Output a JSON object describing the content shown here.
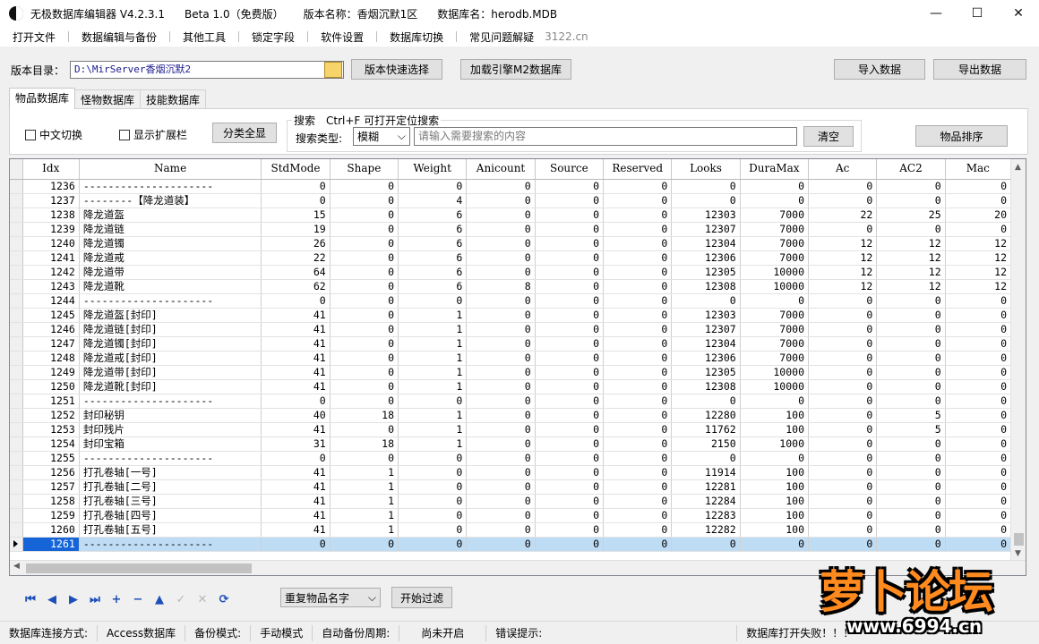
{
  "window": {
    "title_segments": [
      "无极数据库编辑器 V4.2.3.1",
      "Beta 1.0（免费版）",
      "版本名称：香烟沉默1区",
      "数据库名：herodb.MDB"
    ],
    "controls": {
      "minimize": "—",
      "maximize": "☐",
      "close": "✕"
    }
  },
  "menu": {
    "items": [
      "打开文件",
      "数据编辑与备份",
      "其他工具",
      "锁定字段",
      "软件设置",
      "数据库切换",
      "常见问题解疑"
    ],
    "site": "3122.cn"
  },
  "toolbar": {
    "dir_label": "版本目录：",
    "dir_value": "D:\\MirServer香烟沉默2",
    "quick_select": "版本快速选择",
    "load_engine": "加载引擎M2数据库",
    "import": "导入数据",
    "export": "导出数据"
  },
  "tabs": [
    "物品数据库",
    "怪物数据库",
    "技能数据库"
  ],
  "filters": {
    "chinese_switch": "中文切换",
    "show_ext": "显示扩展栏",
    "show_all": "分类全显",
    "search_title": "搜索　Ctrl+F 可打开定位搜索",
    "search_type_label": "搜索类型:",
    "search_type": "模糊",
    "search_placeholder": "请输入需要搜索的内容",
    "clear": "清空",
    "sort": "物品排序"
  },
  "grid": {
    "columns": [
      "Idx",
      "Name",
      "StdMode",
      "Shape",
      "Weight",
      "Anicount",
      "Source",
      "Reserved",
      "Looks",
      "DuraMax",
      "Ac",
      "AC2",
      "Mac"
    ],
    "rows": [
      [
        "1236",
        "---------------------",
        "0",
        "0",
        "0",
        "0",
        "0",
        "0",
        "0",
        "0",
        "0",
        "0",
        "0"
      ],
      [
        "1237",
        "--------【降龙道装】",
        "0",
        "0",
        "4",
        "0",
        "0",
        "0",
        "0",
        "0",
        "0",
        "0",
        "0"
      ],
      [
        "1238",
        "降龙道盔",
        "15",
        "0",
        "6",
        "0",
        "0",
        "0",
        "12303",
        "7000",
        "22",
        "25",
        "20"
      ],
      [
        "1239",
        "降龙道链",
        "19",
        "0",
        "6",
        "0",
        "0",
        "0",
        "12307",
        "7000",
        "0",
        "0",
        "0"
      ],
      [
        "1240",
        "降龙道镯",
        "26",
        "0",
        "6",
        "0",
        "0",
        "0",
        "12304",
        "7000",
        "12",
        "12",
        "12"
      ],
      [
        "1241",
        "降龙道戒",
        "22",
        "0",
        "6",
        "0",
        "0",
        "0",
        "12306",
        "7000",
        "12",
        "12",
        "12"
      ],
      [
        "1242",
        "降龙道带",
        "64",
        "0",
        "6",
        "0",
        "0",
        "0",
        "12305",
        "10000",
        "12",
        "12",
        "12"
      ],
      [
        "1243",
        "降龙道靴",
        "62",
        "0",
        "6",
        "8",
        "0",
        "0",
        "12308",
        "10000",
        "12",
        "12",
        "12"
      ],
      [
        "1244",
        "---------------------",
        "0",
        "0",
        "0",
        "0",
        "0",
        "0",
        "0",
        "0",
        "0",
        "0",
        "0"
      ],
      [
        "1245",
        "降龙道盔[封印]",
        "41",
        "0",
        "1",
        "0",
        "0",
        "0",
        "12303",
        "7000",
        "0",
        "0",
        "0"
      ],
      [
        "1246",
        "降龙道链[封印]",
        "41",
        "0",
        "1",
        "0",
        "0",
        "0",
        "12307",
        "7000",
        "0",
        "0",
        "0"
      ],
      [
        "1247",
        "降龙道镯[封印]",
        "41",
        "0",
        "1",
        "0",
        "0",
        "0",
        "12304",
        "7000",
        "0",
        "0",
        "0"
      ],
      [
        "1248",
        "降龙道戒[封印]",
        "41",
        "0",
        "1",
        "0",
        "0",
        "0",
        "12306",
        "7000",
        "0",
        "0",
        "0"
      ],
      [
        "1249",
        "降龙道带[封印]",
        "41",
        "0",
        "1",
        "0",
        "0",
        "0",
        "12305",
        "10000",
        "0",
        "0",
        "0"
      ],
      [
        "1250",
        "降龙道靴[封印]",
        "41",
        "0",
        "1",
        "0",
        "0",
        "0",
        "12308",
        "10000",
        "0",
        "0",
        "0"
      ],
      [
        "1251",
        "---------------------",
        "0",
        "0",
        "0",
        "0",
        "0",
        "0",
        "0",
        "0",
        "0",
        "0",
        "0"
      ],
      [
        "1252",
        "封印秘钥",
        "40",
        "18",
        "1",
        "0",
        "0",
        "0",
        "12280",
        "100",
        "0",
        "5",
        "0"
      ],
      [
        "1253",
        "封印残片",
        "41",
        "0",
        "1",
        "0",
        "0",
        "0",
        "11762",
        "100",
        "0",
        "5",
        "0"
      ],
      [
        "1254",
        "封印宝箱",
        "31",
        "18",
        "1",
        "0",
        "0",
        "0",
        "2150",
        "1000",
        "0",
        "0",
        "0"
      ],
      [
        "1255",
        "---------------------",
        "0",
        "0",
        "0",
        "0",
        "0",
        "0",
        "0",
        "0",
        "0",
        "0",
        "0"
      ],
      [
        "1256",
        "打孔卷轴[一号]",
        "41",
        "1",
        "0",
        "0",
        "0",
        "0",
        "11914",
        "100",
        "0",
        "0",
        "0"
      ],
      [
        "1257",
        "打孔卷轴[二号]",
        "41",
        "1",
        "0",
        "0",
        "0",
        "0",
        "12281",
        "100",
        "0",
        "0",
        "0"
      ],
      [
        "1258",
        "打孔卷轴[三号]",
        "41",
        "1",
        "0",
        "0",
        "0",
        "0",
        "12284",
        "100",
        "0",
        "0",
        "0"
      ],
      [
        "1259",
        "打孔卷轴[四号]",
        "41",
        "1",
        "0",
        "0",
        "0",
        "0",
        "12283",
        "100",
        "0",
        "0",
        "0"
      ],
      [
        "1260",
        "打孔卷轴[五号]",
        "41",
        "1",
        "0",
        "0",
        "0",
        "0",
        "12282",
        "100",
        "0",
        "0",
        "0"
      ],
      [
        "1261",
        "---------------------",
        "0",
        "0",
        "0",
        "0",
        "0",
        "0",
        "0",
        "0",
        "0",
        "0",
        "0"
      ]
    ],
    "selected_index": 25
  },
  "nav": {
    "icons": [
      {
        "name": "first-record-icon",
        "glyph": "⏮",
        "enabled": true
      },
      {
        "name": "prev-record-icon",
        "glyph": "◀",
        "enabled": true
      },
      {
        "name": "next-record-icon",
        "glyph": "▶",
        "enabled": true
      },
      {
        "name": "last-record-icon",
        "glyph": "⏭",
        "enabled": true
      },
      {
        "name": "add-record-icon",
        "glyph": "+",
        "enabled": true
      },
      {
        "name": "delete-record-icon",
        "glyph": "−",
        "enabled": true
      },
      {
        "name": "edit-record-icon",
        "glyph": "▲",
        "enabled": true
      },
      {
        "name": "post-record-icon",
        "glyph": "✓",
        "enabled": false
      },
      {
        "name": "cancel-record-icon",
        "glyph": "✕",
        "enabled": false
      },
      {
        "name": "refresh-record-icon",
        "glyph": "⟳",
        "enabled": true
      }
    ],
    "filter_combo": "重复物品名字",
    "filter_button": "开始过滤"
  },
  "status": {
    "conn_label": "数据库连接方式:",
    "conn_value": "Access数据库",
    "backup_label": "备份模式:",
    "backup_value": "手动模式",
    "auto_label": "自动备份周期:",
    "auto_value": "尚未开启",
    "error_label": "错误提示:",
    "error_value": "数据库打开失败！！！"
  },
  "watermark": {
    "title": "萝卜论坛",
    "url": "www.6994.cn"
  },
  "colors": {
    "selected_row": "#bfdcf5",
    "selected_idx": "#1565d8",
    "nav_icon": "#1d4fb8"
  }
}
